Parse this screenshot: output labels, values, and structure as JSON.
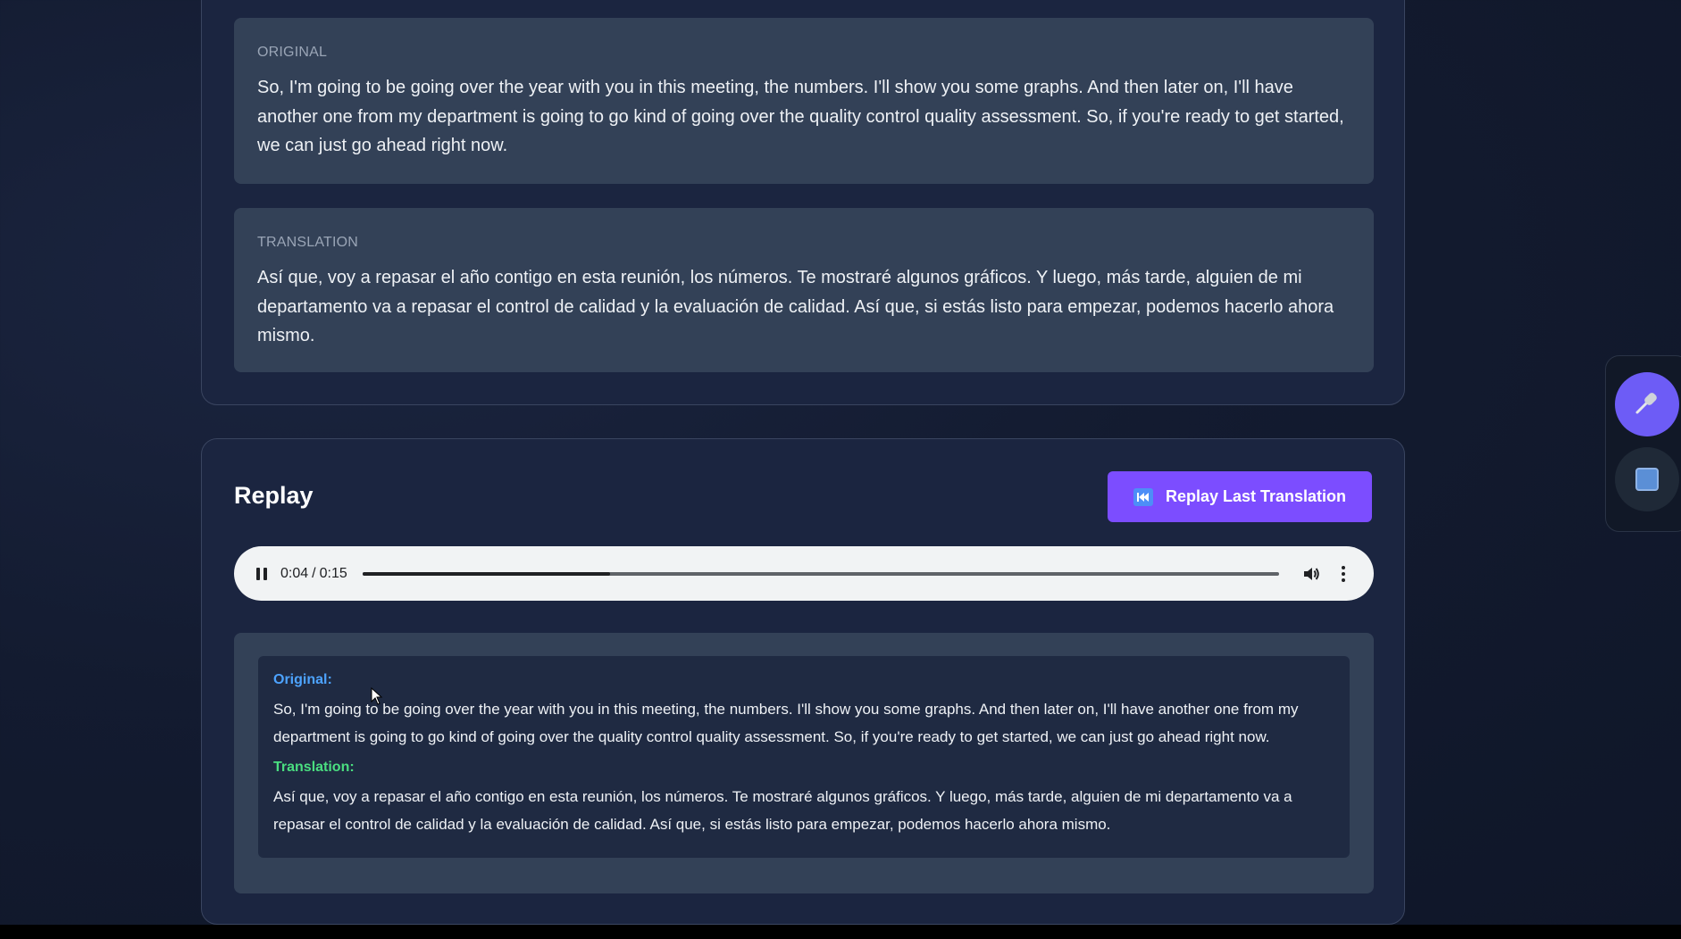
{
  "transcript": {
    "original_label": "ORIGINAL",
    "original_text": "So, I'm going to be going over the year with you in this meeting, the numbers. I'll show you some graphs. And then later on, I'll have another one from my department is going to go kind of going over the quality control quality assessment. So, if you're ready to get started, we can just go ahead right now.",
    "translation_label": "TRANSLATION",
    "translation_text": "Así que, voy a repasar el año contigo en esta reunión, los números. Te mostraré algunos gráficos. Y luego, más tarde, alguien de mi departamento va a repasar el control de calidad y la evaluación de calidad. Así que, si estás listo para empezar, podemos hacerlo ahora mismo."
  },
  "replay": {
    "title": "Replay",
    "button_label": "Replay Last Translation",
    "button_icon": "rewind-icon",
    "player": {
      "current_time": "0:04",
      "duration": "0:15",
      "progress_fraction": 0.27,
      "state": "playing"
    },
    "history": {
      "original_label": "Original:",
      "original_text": "So, I'm going to be going over the year with you in this meeting, the numbers. I'll show you some graphs. And then later on, I'll have another one from my department is going to go kind of going over the quality control quality assessment. So, if you're ready to get started, we can just go ahead right now.",
      "translation_label": "Translation:",
      "translation_text": "Así que, voy a repasar el año contigo en esta reunión, los números. Te mostraré algunos gráficos. Y luego, más tarde, alguien de mi departamento va a repasar el control de calidad y la evaluación de calidad. Así que, si estás listo para empezar, podemos hacerlo ahora mismo."
    }
  },
  "dock": {
    "mic_icon": "microphone-icon",
    "stop_icon": "stop-icon"
  },
  "colors": {
    "accent": "#7c4dff",
    "original_label": "#4da3ff",
    "translation_label": "#4ade80",
    "mic_button": "#6d5cf6"
  }
}
